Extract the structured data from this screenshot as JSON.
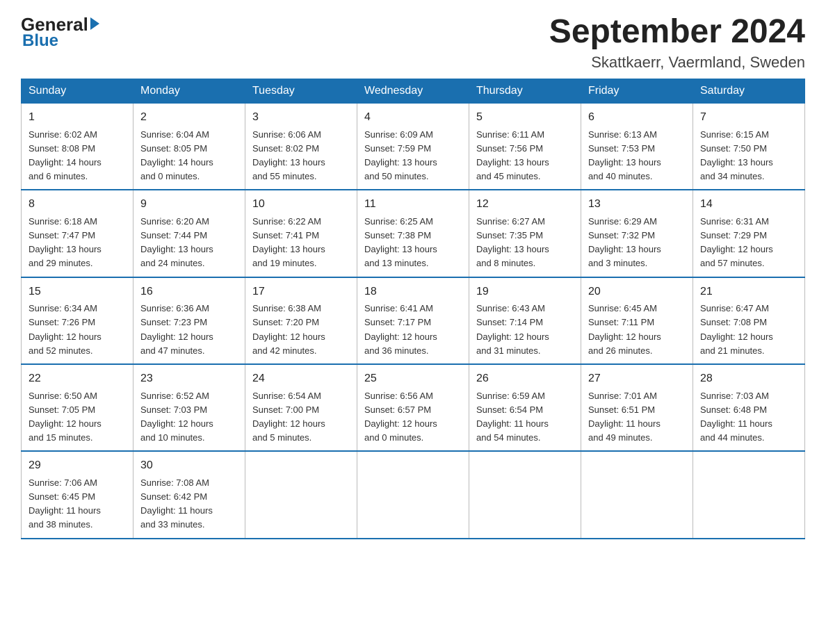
{
  "header": {
    "month_title": "September 2024",
    "location": "Skattkaerr, Vaermland, Sweden",
    "logo_general": "General",
    "logo_blue": "Blue"
  },
  "weekdays": [
    "Sunday",
    "Monday",
    "Tuesday",
    "Wednesday",
    "Thursday",
    "Friday",
    "Saturday"
  ],
  "weeks": [
    [
      {
        "day": "1",
        "info": "Sunrise: 6:02 AM\nSunset: 8:08 PM\nDaylight: 14 hours\nand 6 minutes."
      },
      {
        "day": "2",
        "info": "Sunrise: 6:04 AM\nSunset: 8:05 PM\nDaylight: 14 hours\nand 0 minutes."
      },
      {
        "day": "3",
        "info": "Sunrise: 6:06 AM\nSunset: 8:02 PM\nDaylight: 13 hours\nand 55 minutes."
      },
      {
        "day": "4",
        "info": "Sunrise: 6:09 AM\nSunset: 7:59 PM\nDaylight: 13 hours\nand 50 minutes."
      },
      {
        "day": "5",
        "info": "Sunrise: 6:11 AM\nSunset: 7:56 PM\nDaylight: 13 hours\nand 45 minutes."
      },
      {
        "day": "6",
        "info": "Sunrise: 6:13 AM\nSunset: 7:53 PM\nDaylight: 13 hours\nand 40 minutes."
      },
      {
        "day": "7",
        "info": "Sunrise: 6:15 AM\nSunset: 7:50 PM\nDaylight: 13 hours\nand 34 minutes."
      }
    ],
    [
      {
        "day": "8",
        "info": "Sunrise: 6:18 AM\nSunset: 7:47 PM\nDaylight: 13 hours\nand 29 minutes."
      },
      {
        "day": "9",
        "info": "Sunrise: 6:20 AM\nSunset: 7:44 PM\nDaylight: 13 hours\nand 24 minutes."
      },
      {
        "day": "10",
        "info": "Sunrise: 6:22 AM\nSunset: 7:41 PM\nDaylight: 13 hours\nand 19 minutes."
      },
      {
        "day": "11",
        "info": "Sunrise: 6:25 AM\nSunset: 7:38 PM\nDaylight: 13 hours\nand 13 minutes."
      },
      {
        "day": "12",
        "info": "Sunrise: 6:27 AM\nSunset: 7:35 PM\nDaylight: 13 hours\nand 8 minutes."
      },
      {
        "day": "13",
        "info": "Sunrise: 6:29 AM\nSunset: 7:32 PM\nDaylight: 13 hours\nand 3 minutes."
      },
      {
        "day": "14",
        "info": "Sunrise: 6:31 AM\nSunset: 7:29 PM\nDaylight: 12 hours\nand 57 minutes."
      }
    ],
    [
      {
        "day": "15",
        "info": "Sunrise: 6:34 AM\nSunset: 7:26 PM\nDaylight: 12 hours\nand 52 minutes."
      },
      {
        "day": "16",
        "info": "Sunrise: 6:36 AM\nSunset: 7:23 PM\nDaylight: 12 hours\nand 47 minutes."
      },
      {
        "day": "17",
        "info": "Sunrise: 6:38 AM\nSunset: 7:20 PM\nDaylight: 12 hours\nand 42 minutes."
      },
      {
        "day": "18",
        "info": "Sunrise: 6:41 AM\nSunset: 7:17 PM\nDaylight: 12 hours\nand 36 minutes."
      },
      {
        "day": "19",
        "info": "Sunrise: 6:43 AM\nSunset: 7:14 PM\nDaylight: 12 hours\nand 31 minutes."
      },
      {
        "day": "20",
        "info": "Sunrise: 6:45 AM\nSunset: 7:11 PM\nDaylight: 12 hours\nand 26 minutes."
      },
      {
        "day": "21",
        "info": "Sunrise: 6:47 AM\nSunset: 7:08 PM\nDaylight: 12 hours\nand 21 minutes."
      }
    ],
    [
      {
        "day": "22",
        "info": "Sunrise: 6:50 AM\nSunset: 7:05 PM\nDaylight: 12 hours\nand 15 minutes."
      },
      {
        "day": "23",
        "info": "Sunrise: 6:52 AM\nSunset: 7:03 PM\nDaylight: 12 hours\nand 10 minutes."
      },
      {
        "day": "24",
        "info": "Sunrise: 6:54 AM\nSunset: 7:00 PM\nDaylight: 12 hours\nand 5 minutes."
      },
      {
        "day": "25",
        "info": "Sunrise: 6:56 AM\nSunset: 6:57 PM\nDaylight: 12 hours\nand 0 minutes."
      },
      {
        "day": "26",
        "info": "Sunrise: 6:59 AM\nSunset: 6:54 PM\nDaylight: 11 hours\nand 54 minutes."
      },
      {
        "day": "27",
        "info": "Sunrise: 7:01 AM\nSunset: 6:51 PM\nDaylight: 11 hours\nand 49 minutes."
      },
      {
        "day": "28",
        "info": "Sunrise: 7:03 AM\nSunset: 6:48 PM\nDaylight: 11 hours\nand 44 minutes."
      }
    ],
    [
      {
        "day": "29",
        "info": "Sunrise: 7:06 AM\nSunset: 6:45 PM\nDaylight: 11 hours\nand 38 minutes."
      },
      {
        "day": "30",
        "info": "Sunrise: 7:08 AM\nSunset: 6:42 PM\nDaylight: 11 hours\nand 33 minutes."
      },
      {
        "day": "",
        "info": ""
      },
      {
        "day": "",
        "info": ""
      },
      {
        "day": "",
        "info": ""
      },
      {
        "day": "",
        "info": ""
      },
      {
        "day": "",
        "info": ""
      }
    ]
  ]
}
